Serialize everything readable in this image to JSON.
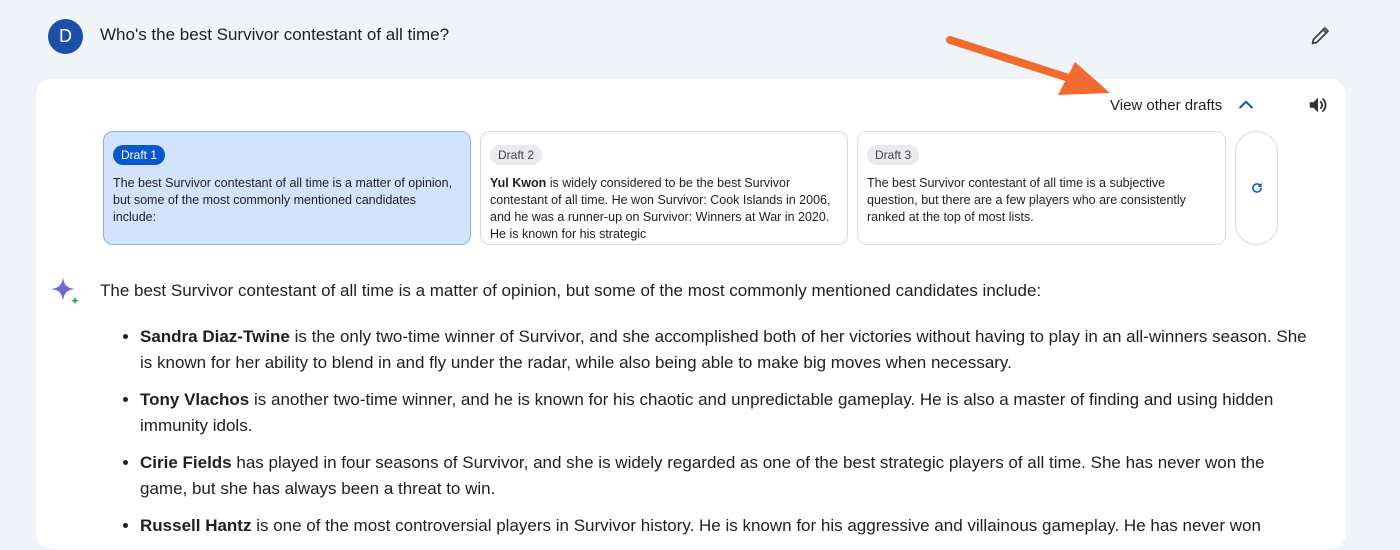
{
  "user": {
    "avatar_letter": "D"
  },
  "prompt": {
    "text": "Who's the best Survivor contestant of all time?"
  },
  "icons": {
    "edit": "pencil-icon",
    "expand": "chevron-up-icon",
    "speaker": "speaker-icon",
    "regenerate": "refresh-icon",
    "assistant": "sparkle-icon"
  },
  "colors": {
    "accent": "#0b57d0",
    "arrow": "#f26b2e",
    "selected_draft_bg": "#d3e3fd"
  },
  "toolbar": {
    "view_drafts_label": "View other drafts"
  },
  "drafts": [
    {
      "label": "Draft 1",
      "text": "The best Survivor contestant of all time is a matter of opinion, but some of the most commonly mentioned candidates include:"
    },
    {
      "label": "Draft 2",
      "bold": "Yul Kwon",
      "text": " is widely considered to be the best Survivor contestant of all time. He won Survivor: Cook Islands in 2006, and he was a runner-up on Survivor: Winners at War in 2020. He is known for his strategic"
    },
    {
      "label": "Draft 3",
      "text": "The best Survivor contestant of all time is a subjective question, but there are a few players who are consistently ranked at the top of most lists."
    }
  ],
  "response": {
    "intro": "The best Survivor contestant of all time is a matter of opinion, but some of the most commonly mentioned candidates include:",
    "items": [
      {
        "name": "Sandra Diaz-Twine",
        "text": " is the only two-time winner of Survivor, and she accomplished both of her victories without having to play in an all-winners season. She is known for her ability to blend in and fly under the radar, while also being able to make big moves when necessary."
      },
      {
        "name": "Tony Vlachos",
        "text": " is another two-time winner, and he is known for his chaotic and unpredictable gameplay. He is also a master of finding and using hidden immunity idols."
      },
      {
        "name": "Cirie Fields",
        "text": " has played in four seasons of Survivor, and she is widely regarded as one of the best strategic players of all time. She has never won the game, but she has always been a threat to win."
      },
      {
        "name": "Russell Hantz",
        "text": " is one of the most controversial players in Survivor history. He is known for his aggressive and villainous gameplay. He has never won"
      }
    ]
  }
}
